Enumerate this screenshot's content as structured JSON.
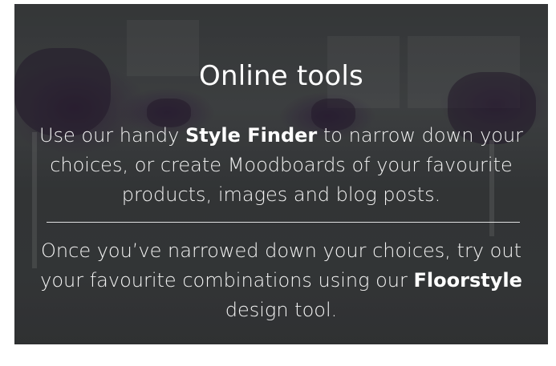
{
  "hero": {
    "title": "Online tools",
    "paragraph1": {
      "before": "Use our handy ",
      "link": "Style Finder",
      "after": " to narrow down your choices, or create Moodboards of your favourite products, images and blog posts."
    },
    "paragraph2": {
      "before": "Once you’ve narrowed down your choices, try out your favourite combinations using our ",
      "link": "Floorstyle",
      "after": " design tool."
    }
  },
  "colors": {
    "text": "#ffffff",
    "overlay": "#3f4244"
  }
}
